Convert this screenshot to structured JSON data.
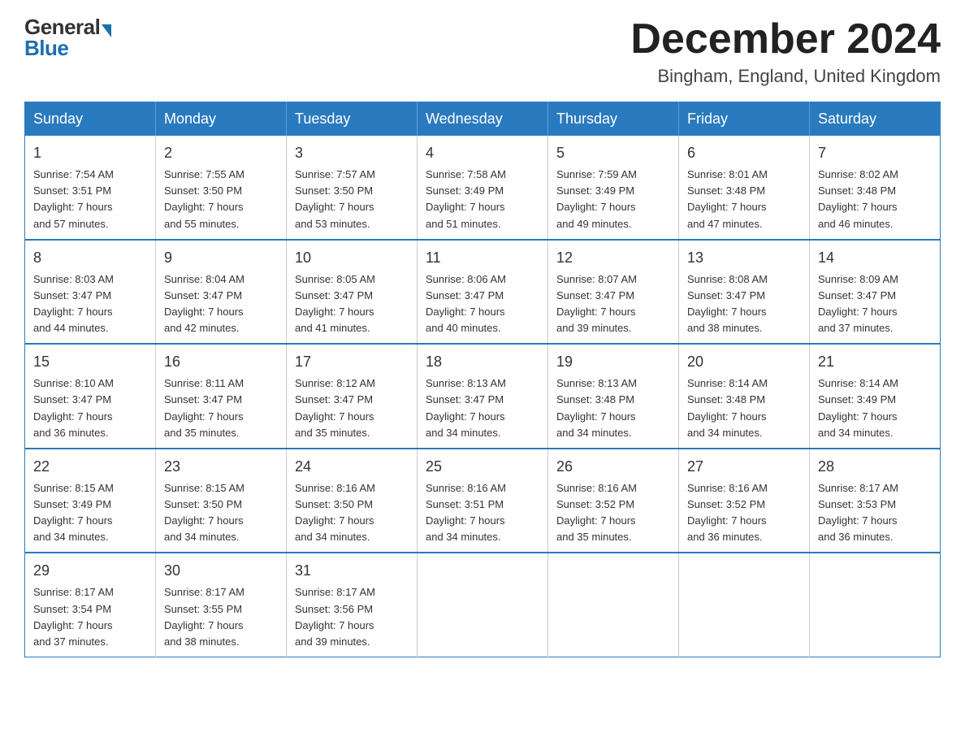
{
  "header": {
    "logo_general": "General",
    "logo_blue": "Blue",
    "month_title": "December 2024",
    "location": "Bingham, England, United Kingdom"
  },
  "calendar": {
    "days_of_week": [
      "Sunday",
      "Monday",
      "Tuesday",
      "Wednesday",
      "Thursday",
      "Friday",
      "Saturday"
    ],
    "weeks": [
      [
        {
          "day": "1",
          "sunrise": "7:54 AM",
          "sunset": "3:51 PM",
          "daylight": "7 hours and 57 minutes."
        },
        {
          "day": "2",
          "sunrise": "7:55 AM",
          "sunset": "3:50 PM",
          "daylight": "7 hours and 55 minutes."
        },
        {
          "day": "3",
          "sunrise": "7:57 AM",
          "sunset": "3:50 PM",
          "daylight": "7 hours and 53 minutes."
        },
        {
          "day": "4",
          "sunrise": "7:58 AM",
          "sunset": "3:49 PM",
          "daylight": "7 hours and 51 minutes."
        },
        {
          "day": "5",
          "sunrise": "7:59 AM",
          "sunset": "3:49 PM",
          "daylight": "7 hours and 49 minutes."
        },
        {
          "day": "6",
          "sunrise": "8:01 AM",
          "sunset": "3:48 PM",
          "daylight": "7 hours and 47 minutes."
        },
        {
          "day": "7",
          "sunrise": "8:02 AM",
          "sunset": "3:48 PM",
          "daylight": "7 hours and 46 minutes."
        }
      ],
      [
        {
          "day": "8",
          "sunrise": "8:03 AM",
          "sunset": "3:47 PM",
          "daylight": "7 hours and 44 minutes."
        },
        {
          "day": "9",
          "sunrise": "8:04 AM",
          "sunset": "3:47 PM",
          "daylight": "7 hours and 42 minutes."
        },
        {
          "day": "10",
          "sunrise": "8:05 AM",
          "sunset": "3:47 PM",
          "daylight": "7 hours and 41 minutes."
        },
        {
          "day": "11",
          "sunrise": "8:06 AM",
          "sunset": "3:47 PM",
          "daylight": "7 hours and 40 minutes."
        },
        {
          "day": "12",
          "sunrise": "8:07 AM",
          "sunset": "3:47 PM",
          "daylight": "7 hours and 39 minutes."
        },
        {
          "day": "13",
          "sunrise": "8:08 AM",
          "sunset": "3:47 PM",
          "daylight": "7 hours and 38 minutes."
        },
        {
          "day": "14",
          "sunrise": "8:09 AM",
          "sunset": "3:47 PM",
          "daylight": "7 hours and 37 minutes."
        }
      ],
      [
        {
          "day": "15",
          "sunrise": "8:10 AM",
          "sunset": "3:47 PM",
          "daylight": "7 hours and 36 minutes."
        },
        {
          "day": "16",
          "sunrise": "8:11 AM",
          "sunset": "3:47 PM",
          "daylight": "7 hours and 35 minutes."
        },
        {
          "day": "17",
          "sunrise": "8:12 AM",
          "sunset": "3:47 PM",
          "daylight": "7 hours and 35 minutes."
        },
        {
          "day": "18",
          "sunrise": "8:13 AM",
          "sunset": "3:47 PM",
          "daylight": "7 hours and 34 minutes."
        },
        {
          "day": "19",
          "sunrise": "8:13 AM",
          "sunset": "3:48 PM",
          "daylight": "7 hours and 34 minutes."
        },
        {
          "day": "20",
          "sunrise": "8:14 AM",
          "sunset": "3:48 PM",
          "daylight": "7 hours and 34 minutes."
        },
        {
          "day": "21",
          "sunrise": "8:14 AM",
          "sunset": "3:49 PM",
          "daylight": "7 hours and 34 minutes."
        }
      ],
      [
        {
          "day": "22",
          "sunrise": "8:15 AM",
          "sunset": "3:49 PM",
          "daylight": "7 hours and 34 minutes."
        },
        {
          "day": "23",
          "sunrise": "8:15 AM",
          "sunset": "3:50 PM",
          "daylight": "7 hours and 34 minutes."
        },
        {
          "day": "24",
          "sunrise": "8:16 AM",
          "sunset": "3:50 PM",
          "daylight": "7 hours and 34 minutes."
        },
        {
          "day": "25",
          "sunrise": "8:16 AM",
          "sunset": "3:51 PM",
          "daylight": "7 hours and 34 minutes."
        },
        {
          "day": "26",
          "sunrise": "8:16 AM",
          "sunset": "3:52 PM",
          "daylight": "7 hours and 35 minutes."
        },
        {
          "day": "27",
          "sunrise": "8:16 AM",
          "sunset": "3:52 PM",
          "daylight": "7 hours and 36 minutes."
        },
        {
          "day": "28",
          "sunrise": "8:17 AM",
          "sunset": "3:53 PM",
          "daylight": "7 hours and 36 minutes."
        }
      ],
      [
        {
          "day": "29",
          "sunrise": "8:17 AM",
          "sunset": "3:54 PM",
          "daylight": "7 hours and 37 minutes."
        },
        {
          "day": "30",
          "sunrise": "8:17 AM",
          "sunset": "3:55 PM",
          "daylight": "7 hours and 38 minutes."
        },
        {
          "day": "31",
          "sunrise": "8:17 AM",
          "sunset": "3:56 PM",
          "daylight": "7 hours and 39 minutes."
        },
        null,
        null,
        null,
        null
      ]
    ],
    "sunrise_label": "Sunrise:",
    "sunset_label": "Sunset:",
    "daylight_label": "Daylight:"
  }
}
